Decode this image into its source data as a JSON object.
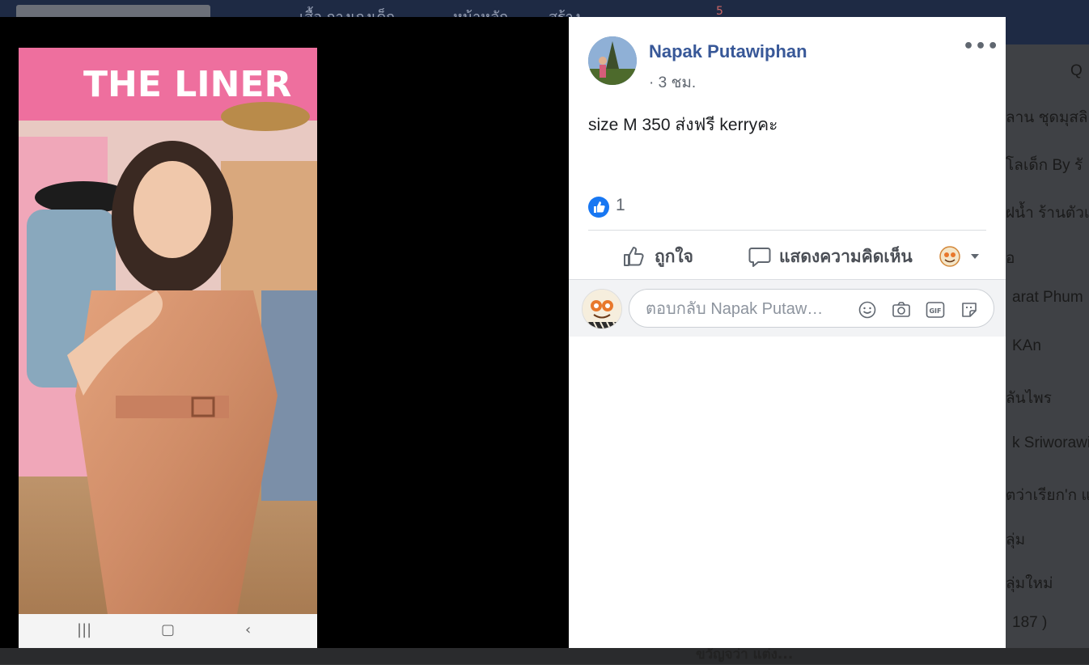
{
  "background": {
    "nav_items": [
      "เสื้อ กางเกงเด็ก",
      "หน้าหลัก",
      "สร้าง"
    ],
    "notification_count": "5",
    "sidebar_items": [
      "Q",
      "ลาน ชุดมุสลิ",
      "โลเด็ก By รั",
      "ฝน้ำ ร้านตัวเล",
      "อ",
      "arat Phum",
      "KAn",
      "ลันไพร",
      "k Sriworawi",
      "ตว่าเรียก'ก แ",
      "ลุ่ม",
      "ลุ่มใหม่",
      "187 )"
    ],
    "chat_label": "ขวัญจว่า แต่ง..."
  },
  "post": {
    "author": "Napak Putawiphan",
    "time": "· 3 ชม.",
    "more_label": "•••",
    "text": "size M 350 ส่งฟรี kerryคะ",
    "reaction_count": "1",
    "actions": {
      "like": "ถูกใจ",
      "comment": "แสดงความคิดเห็น"
    },
    "comment_placeholder": "ตอบกลับ Napak Putaw…",
    "comment_icons": [
      "emoji-icon",
      "camera-icon",
      "gif-icon",
      "sticker-icon"
    ],
    "gif_label": "GIF"
  },
  "video": {
    "banner_text": "THE LINER"
  },
  "colors": {
    "author_link": "#385898",
    "like_blue": "#1877f2",
    "overlay": "#000000"
  }
}
